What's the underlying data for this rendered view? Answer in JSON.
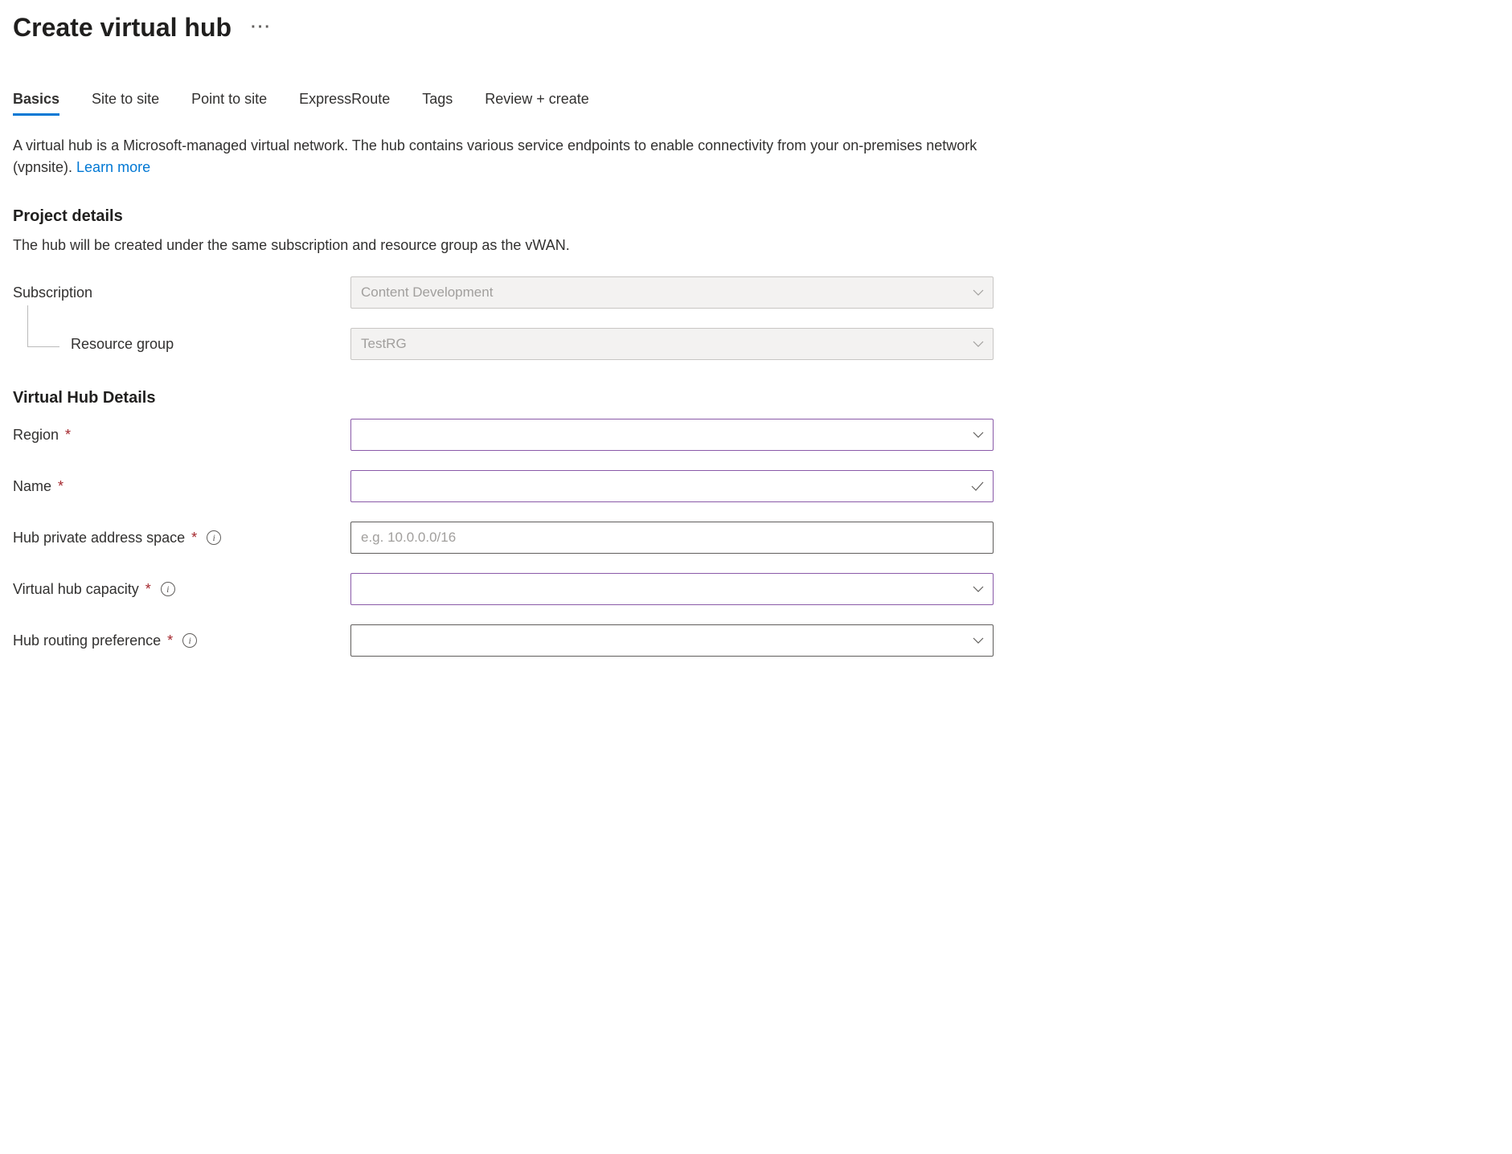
{
  "header": {
    "title": "Create virtual hub"
  },
  "tabs": {
    "basics": "Basics",
    "site_to_site": "Site to site",
    "point_to_site": "Point to site",
    "expressroute": "ExpressRoute",
    "tags": "Tags",
    "review_create": "Review + create"
  },
  "description": {
    "text": "A virtual hub is a Microsoft-managed virtual network. The hub contains various service endpoints to enable connectivity from your on-premises network (vpnsite).  ",
    "learn_more": "Learn more"
  },
  "project_details": {
    "heading": "Project details",
    "subtext": "The hub will be created under the same subscription and resource group as the vWAN.",
    "subscription_label": "Subscription",
    "subscription_value": "Content Development",
    "resource_group_label": "Resource group",
    "resource_group_value": "TestRG"
  },
  "hub_details": {
    "heading": "Virtual Hub Details",
    "region_label": "Region",
    "region_value": "",
    "name_label": "Name",
    "name_value": "",
    "address_space_label": "Hub private address space",
    "address_space_placeholder": "e.g. 10.0.0.0/16",
    "address_space_value": "",
    "capacity_label": "Virtual hub capacity",
    "capacity_value": "",
    "routing_pref_label": "Hub routing preference",
    "routing_pref_value": ""
  }
}
